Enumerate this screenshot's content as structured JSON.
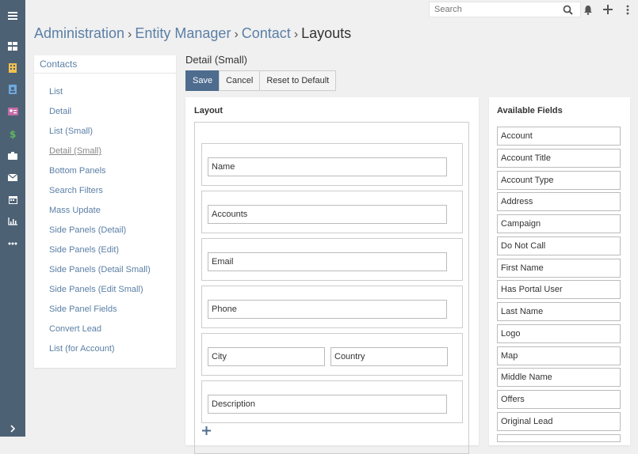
{
  "search": {
    "placeholder": "Search"
  },
  "rail": {
    "icons": [
      "menu-icon",
      "dashboard-icon",
      "building-icon",
      "contact-icon",
      "id-card-icon",
      "dollar-icon",
      "briefcase-icon",
      "envelope-icon",
      "calendar-icon",
      "chart-icon",
      "more-icon",
      "expand-icon"
    ],
    "colors": {
      "building": "#f2c14e",
      "contact": "#6fa8dc",
      "id_card": "#c36ba5",
      "dollar": "#5cb85c",
      "default": "#ffffff"
    }
  },
  "breadcrumb": {
    "item1": "Administration",
    "item2": "Entity Manager",
    "item3": "Contact",
    "current": "Layouts",
    "separator": "›"
  },
  "sidebar": {
    "header": "Contacts",
    "items": [
      {
        "label": "List"
      },
      {
        "label": "Detail"
      },
      {
        "label": "List (Small)"
      },
      {
        "label": "Detail (Small)"
      },
      {
        "label": "Bottom Panels"
      },
      {
        "label": "Search Filters"
      },
      {
        "label": "Mass Update"
      },
      {
        "label": "Side Panels (Detail)"
      },
      {
        "label": "Side Panels (Edit)"
      },
      {
        "label": "Side Panels (Detail Small)"
      },
      {
        "label": "Side Panels (Edit Small)"
      },
      {
        "label": "Side Panel Fields"
      },
      {
        "label": "Convert Lead"
      },
      {
        "label": "List (for Account)"
      }
    ]
  },
  "main": {
    "title": "Detail (Small)",
    "buttons": {
      "save": "Save",
      "cancel": "Cancel",
      "reset": "Reset to Default"
    },
    "layout": {
      "heading": "Layout",
      "rows": [
        [
          "Name"
        ],
        [
          "Accounts"
        ],
        [
          "Email"
        ],
        [
          "Phone"
        ],
        [
          "City",
          "Country"
        ],
        [
          "Description"
        ]
      ]
    },
    "available": {
      "heading": "Available Fields",
      "fields": [
        "Account",
        "Account Title",
        "Account Type",
        "Address",
        "Campaign",
        "Do Not Call",
        "First Name",
        "Has Portal User",
        "Last Name",
        "Logo",
        "Map",
        "Middle Name",
        "Offers",
        "Original Lead"
      ]
    }
  },
  "colors": {
    "accent": "#5b7fa6",
    "primary_button": "#4d6c8e",
    "rail": "#4d6175"
  }
}
